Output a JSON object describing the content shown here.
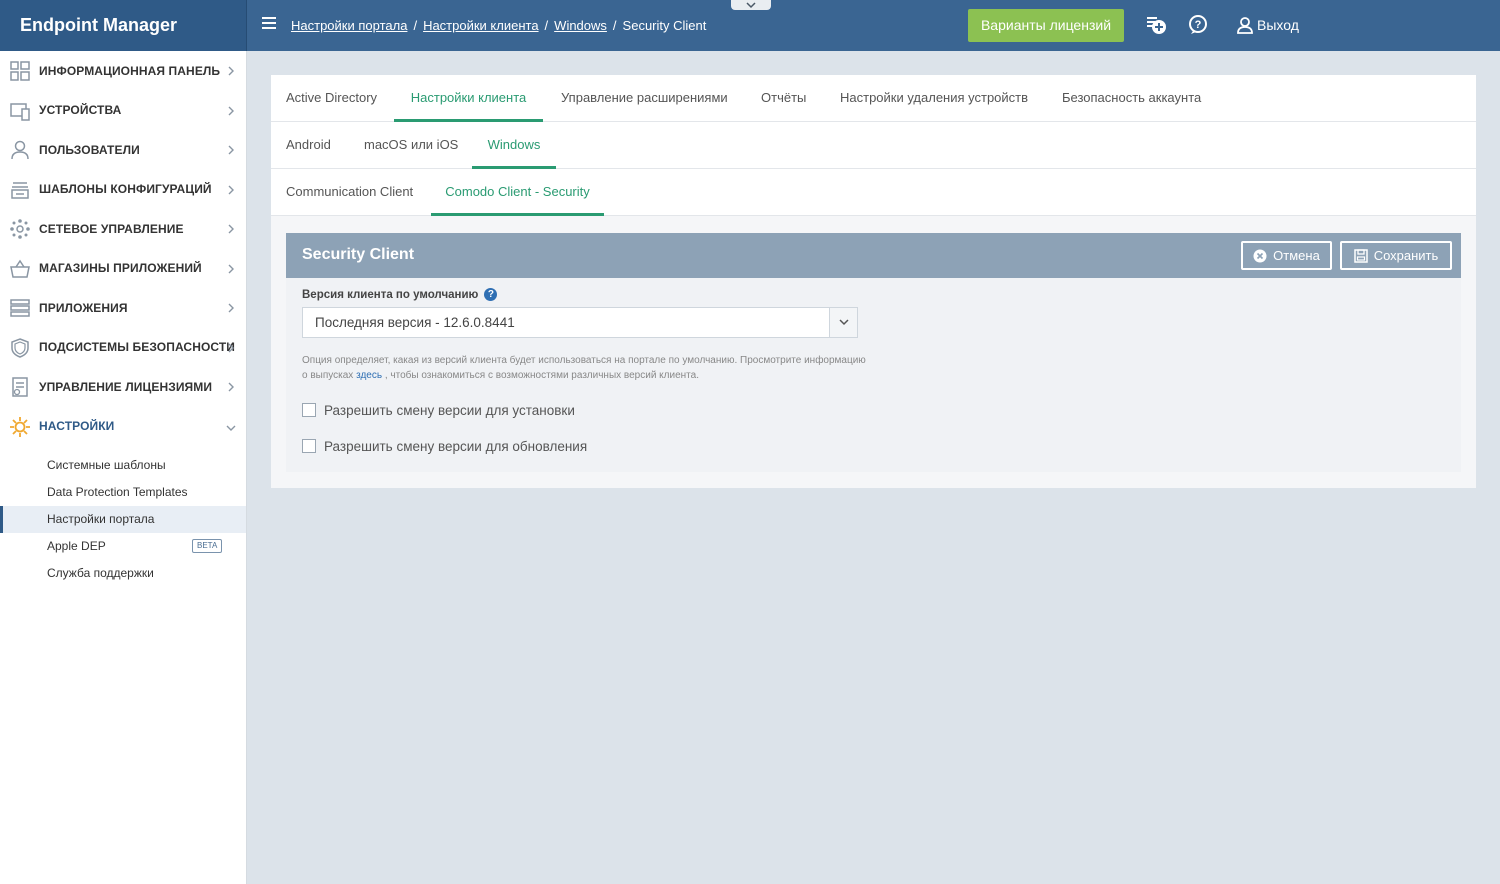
{
  "app": {
    "title": "Endpoint Manager"
  },
  "breadcrumb": {
    "items": [
      "Настройки портала",
      "Настройки клиента",
      "Windows"
    ],
    "current": "Security Client"
  },
  "header": {
    "license_button": "Варианты лицензий",
    "add_icon": "add-device-icon",
    "help_icon": "help-icon",
    "logout_label": "Выход"
  },
  "sidebar": {
    "items": [
      {
        "label": "ИНФОРМАЦИОННАЯ ПАНЕЛЬ",
        "icon": "dashboard-icon"
      },
      {
        "label": "УСТРОЙСТВА",
        "icon": "devices-icon"
      },
      {
        "label": "ПОЛЬЗОВАТЕЛИ",
        "icon": "user-icon"
      },
      {
        "label": "ШАБЛОНЫ КОНФИГУРАЦИЙ",
        "icon": "templates-icon"
      },
      {
        "label": "СЕТЕВОЕ УПРАВЛЕНИЕ",
        "icon": "network-icon"
      },
      {
        "label": "МАГАЗИНЫ ПРИЛОЖЕНИЙ",
        "icon": "basket-icon"
      },
      {
        "label": "ПРИЛОЖЕНИЯ",
        "icon": "apps-icon"
      },
      {
        "label": "ПОДСИСТЕМЫ БЕЗОПАСНОСТИ",
        "icon": "shield-icon"
      },
      {
        "label": "УПРАВЛЕНИЕ ЛИЦЕНЗИЯМИ",
        "icon": "license-icon"
      },
      {
        "label": "НАСТРОЙКИ",
        "icon": "gear-icon"
      }
    ],
    "settings_sub": [
      "Системные шаблоны",
      "Data Protection Templates",
      "Настройки портала",
      "Apple DEP",
      "Служба поддержки"
    ],
    "beta_badge": "BETA"
  },
  "tabs": {
    "main": [
      "Active Directory",
      "Настройки клиента",
      "Управление расширениями",
      "Отчёты",
      "Настройки удаления устройств",
      "Безопасность аккаунта"
    ],
    "os": [
      "Android",
      "macOS или iOS",
      "Windows"
    ],
    "client": [
      "Communication Client",
      "Comodo Client - Security"
    ]
  },
  "panel": {
    "title": "Security Client",
    "cancel_label": "Отмена",
    "save_label": "Сохранить",
    "field_label": "Версия клиента по умолчанию",
    "select_value": "Последняя версия - 12.6.0.8441",
    "hint_part1": "Опция определяет, какая из версий клиента будет использоваться на портале по умолчанию. Просмотрите информацию о выпусках",
    "hint_link": "здесь",
    "hint_part2": ", чтобы ознакомиться с возможностями различных версий клиента.",
    "check_install": "Разрешить смену версии для установки",
    "check_update": "Разрешить смену версии для обновления"
  },
  "colors": {
    "header_bg": "#3a6592",
    "brand_bg": "#2f5a87",
    "license_green": "#8cc152",
    "tab_active": "#2a9b72",
    "panel_head": "#8da2b6"
  }
}
